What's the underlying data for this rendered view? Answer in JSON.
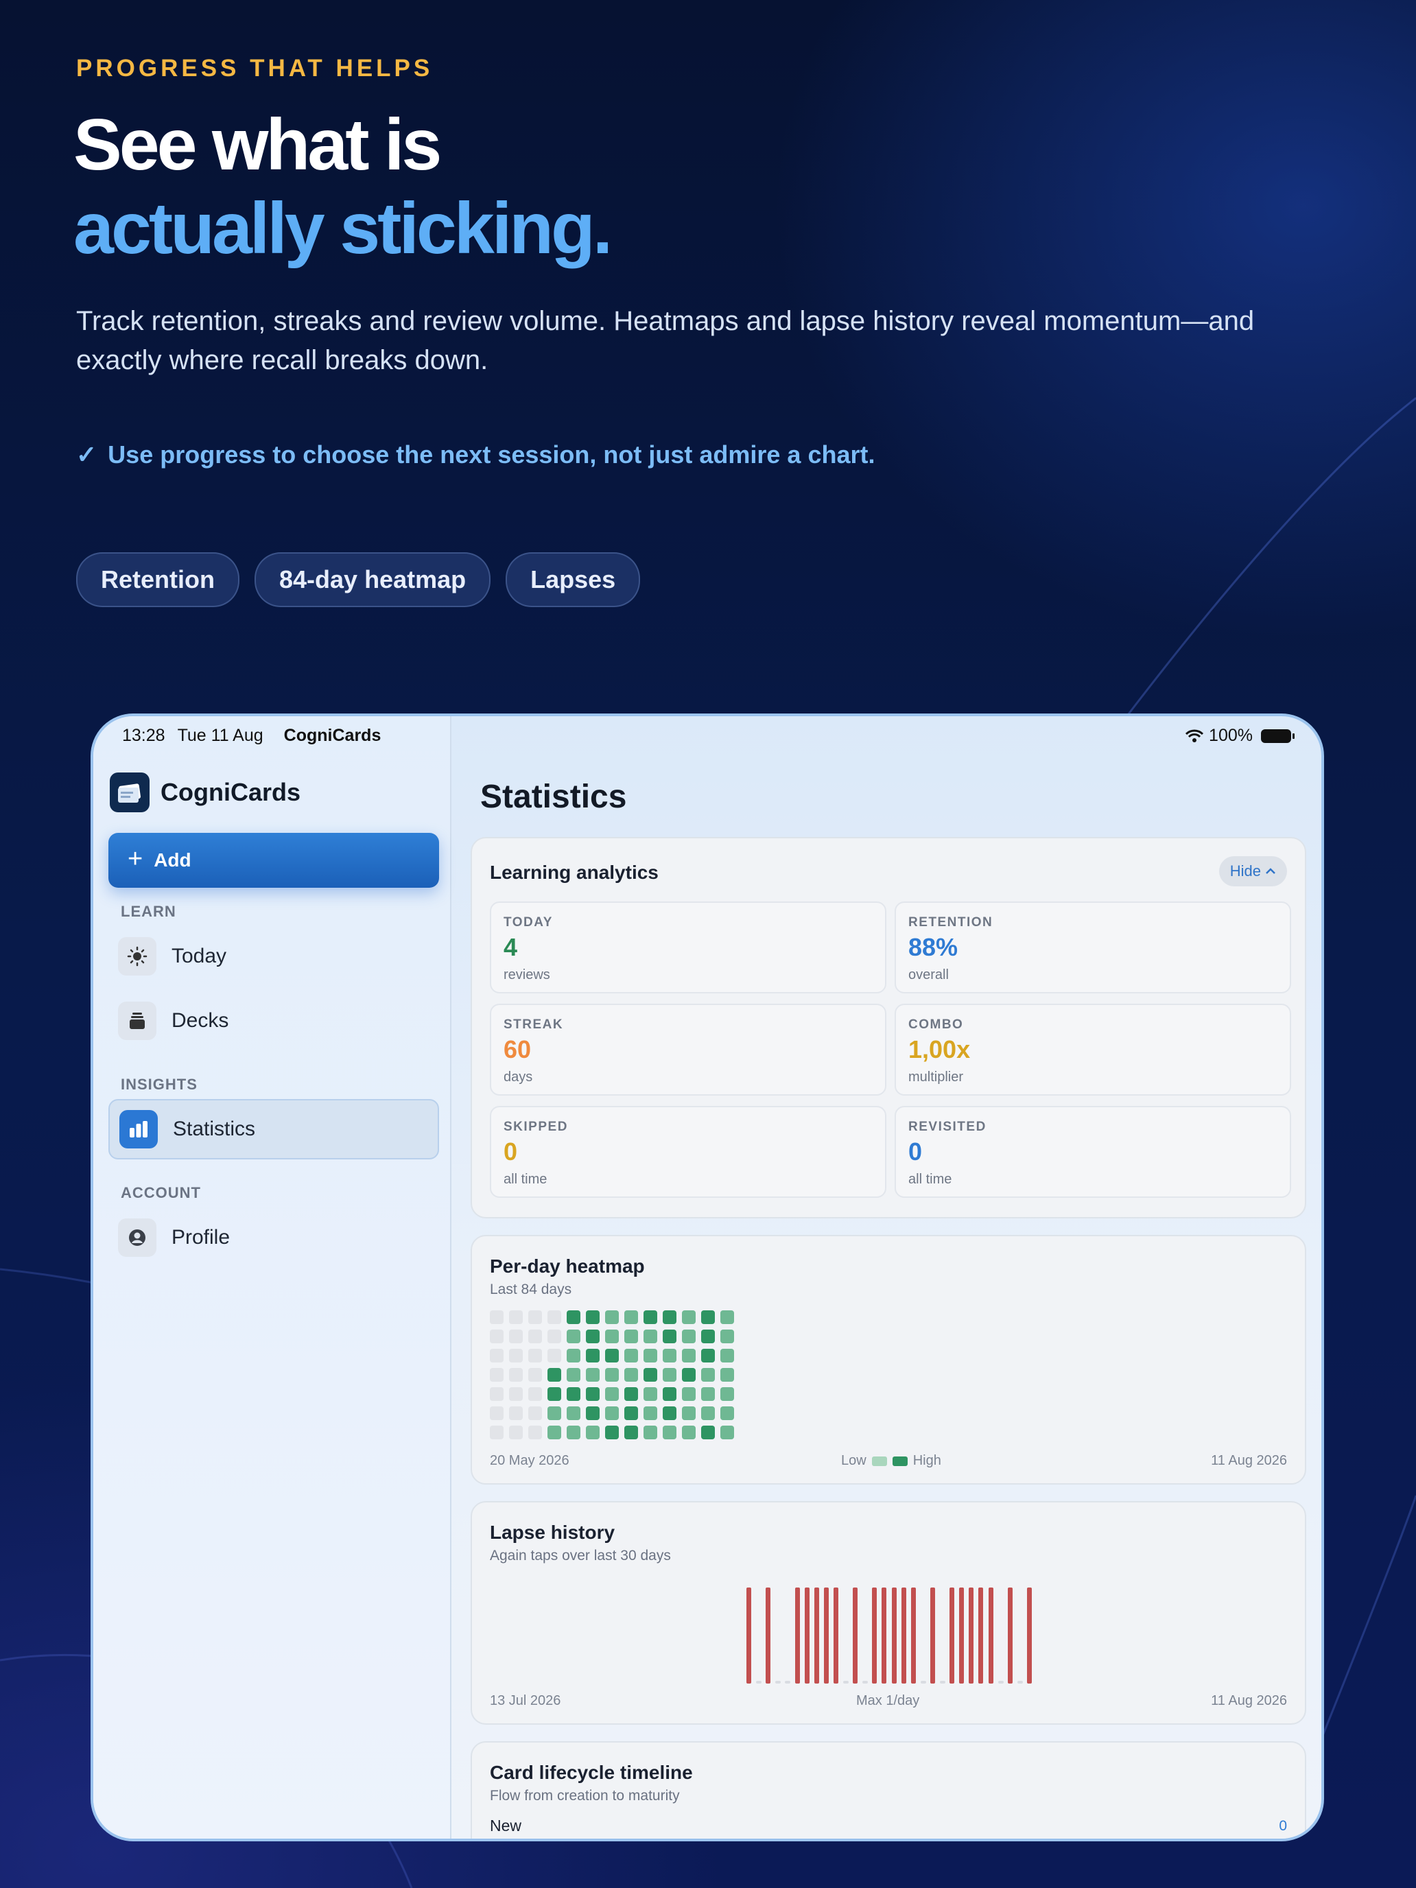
{
  "hero": {
    "eyebrow": "PROGRESS THAT HELPS",
    "headline_line1": "See what is",
    "headline_line2": "actually sticking.",
    "subtext": "Track retention, streaks and review volume. Heatmaps and lapse history reveal momentum—and exactly where recall breaks down.",
    "check_mark": "✓",
    "check_text": "Use progress to choose the next session, not just admire a chart.",
    "chips": [
      "Retention",
      "84-day heatmap",
      "Lapses"
    ]
  },
  "colors": {
    "accent_orange": "#f5b843",
    "accent_blue": "#5eaef6",
    "heat_high": "#2e9462",
    "heat_low": "#a9d6bd",
    "lapse_bar": "#c24f4f"
  },
  "status_bar": {
    "time": "13:28",
    "date": "Tue 11 Aug",
    "app": "CogniCards",
    "battery": "100%",
    "wifi_icon": "wifi-icon",
    "battery_icon": "battery-icon"
  },
  "sidebar": {
    "app_name": "CogniCards",
    "add_label": "Add",
    "sections": [
      {
        "label": "LEARN",
        "items": [
          {
            "label": "Today",
            "icon": "sun-icon"
          },
          {
            "label": "Decks",
            "icon": "stack-icon"
          }
        ]
      },
      {
        "label": "INSIGHTS",
        "items": [
          {
            "label": "Statistics",
            "icon": "bar-chart-icon",
            "active": true
          }
        ]
      },
      {
        "label": "ACCOUNT",
        "items": [
          {
            "label": "Profile",
            "icon": "person-icon"
          }
        ]
      }
    ]
  },
  "main": {
    "title": "Statistics",
    "analytics": {
      "title": "Learning analytics",
      "hide_label": "Hide",
      "metrics": [
        {
          "label": "TODAY",
          "value": "4",
          "unit": "reviews",
          "color": "#2b8a55"
        },
        {
          "label": "RETENTION",
          "value": "88%",
          "unit": "overall",
          "color": "#2f7bd3"
        },
        {
          "label": "STREAK",
          "value": "60",
          "unit": "days",
          "color": "#ef8a3e"
        },
        {
          "label": "COMBO",
          "value": "1,00x",
          "unit": "multiplier",
          "color": "#d9a521"
        },
        {
          "label": "SKIPPED",
          "value": "0",
          "unit": "all time",
          "color": "#d9a521"
        },
        {
          "label": "REVISITED",
          "value": "0",
          "unit": "all time",
          "color": "#2f7bd3"
        }
      ]
    },
    "heatmap": {
      "title": "Per-day heatmap",
      "subtitle": "Last 84 days",
      "start_label": "20 May 2026",
      "end_label": "11 Aug 2026",
      "legend_low": "Low",
      "legend_high": "High",
      "weeks": [
        [
          0,
          0,
          0,
          0,
          0,
          0,
          0
        ],
        [
          0,
          0,
          0,
          0,
          0,
          0,
          0
        ],
        [
          0,
          0,
          0,
          0,
          0,
          0,
          0
        ],
        [
          0,
          0,
          0,
          3,
          3,
          2,
          2
        ],
        [
          3,
          2,
          2,
          2,
          3,
          2,
          2
        ],
        [
          3,
          3,
          3,
          2,
          3,
          3,
          2
        ],
        [
          2,
          2,
          3,
          2,
          2,
          2,
          3
        ],
        [
          2,
          2,
          2,
          2,
          3,
          3,
          3
        ],
        [
          3,
          2,
          2,
          3,
          2,
          2,
          2
        ],
        [
          3,
          3,
          2,
          2,
          3,
          3,
          2
        ],
        [
          2,
          2,
          2,
          3,
          2,
          2,
          2
        ],
        [
          3,
          3,
          3,
          2,
          2,
          2,
          3
        ],
        [
          2,
          2,
          2,
          2,
          2,
          2,
          2
        ]
      ]
    },
    "lapses": {
      "title": "Lapse history",
      "subtitle": "Again taps over last 30 days",
      "start_label": "13 Jul 2026",
      "mid_label": "Max 1/day",
      "end_label": "11 Aug 2026",
      "days": [
        1,
        0,
        1,
        0,
        0,
        1,
        1,
        1,
        1,
        1,
        0,
        1,
        0,
        1,
        1,
        1,
        1,
        1,
        0,
        1,
        0,
        1,
        1,
        1,
        1,
        1,
        0,
        1,
        0,
        1
      ]
    },
    "lifecycle": {
      "title": "Card lifecycle timeline",
      "subtitle": "Flow from creation to maturity",
      "rows": [
        {
          "label": "New",
          "value": "0"
        }
      ]
    }
  }
}
